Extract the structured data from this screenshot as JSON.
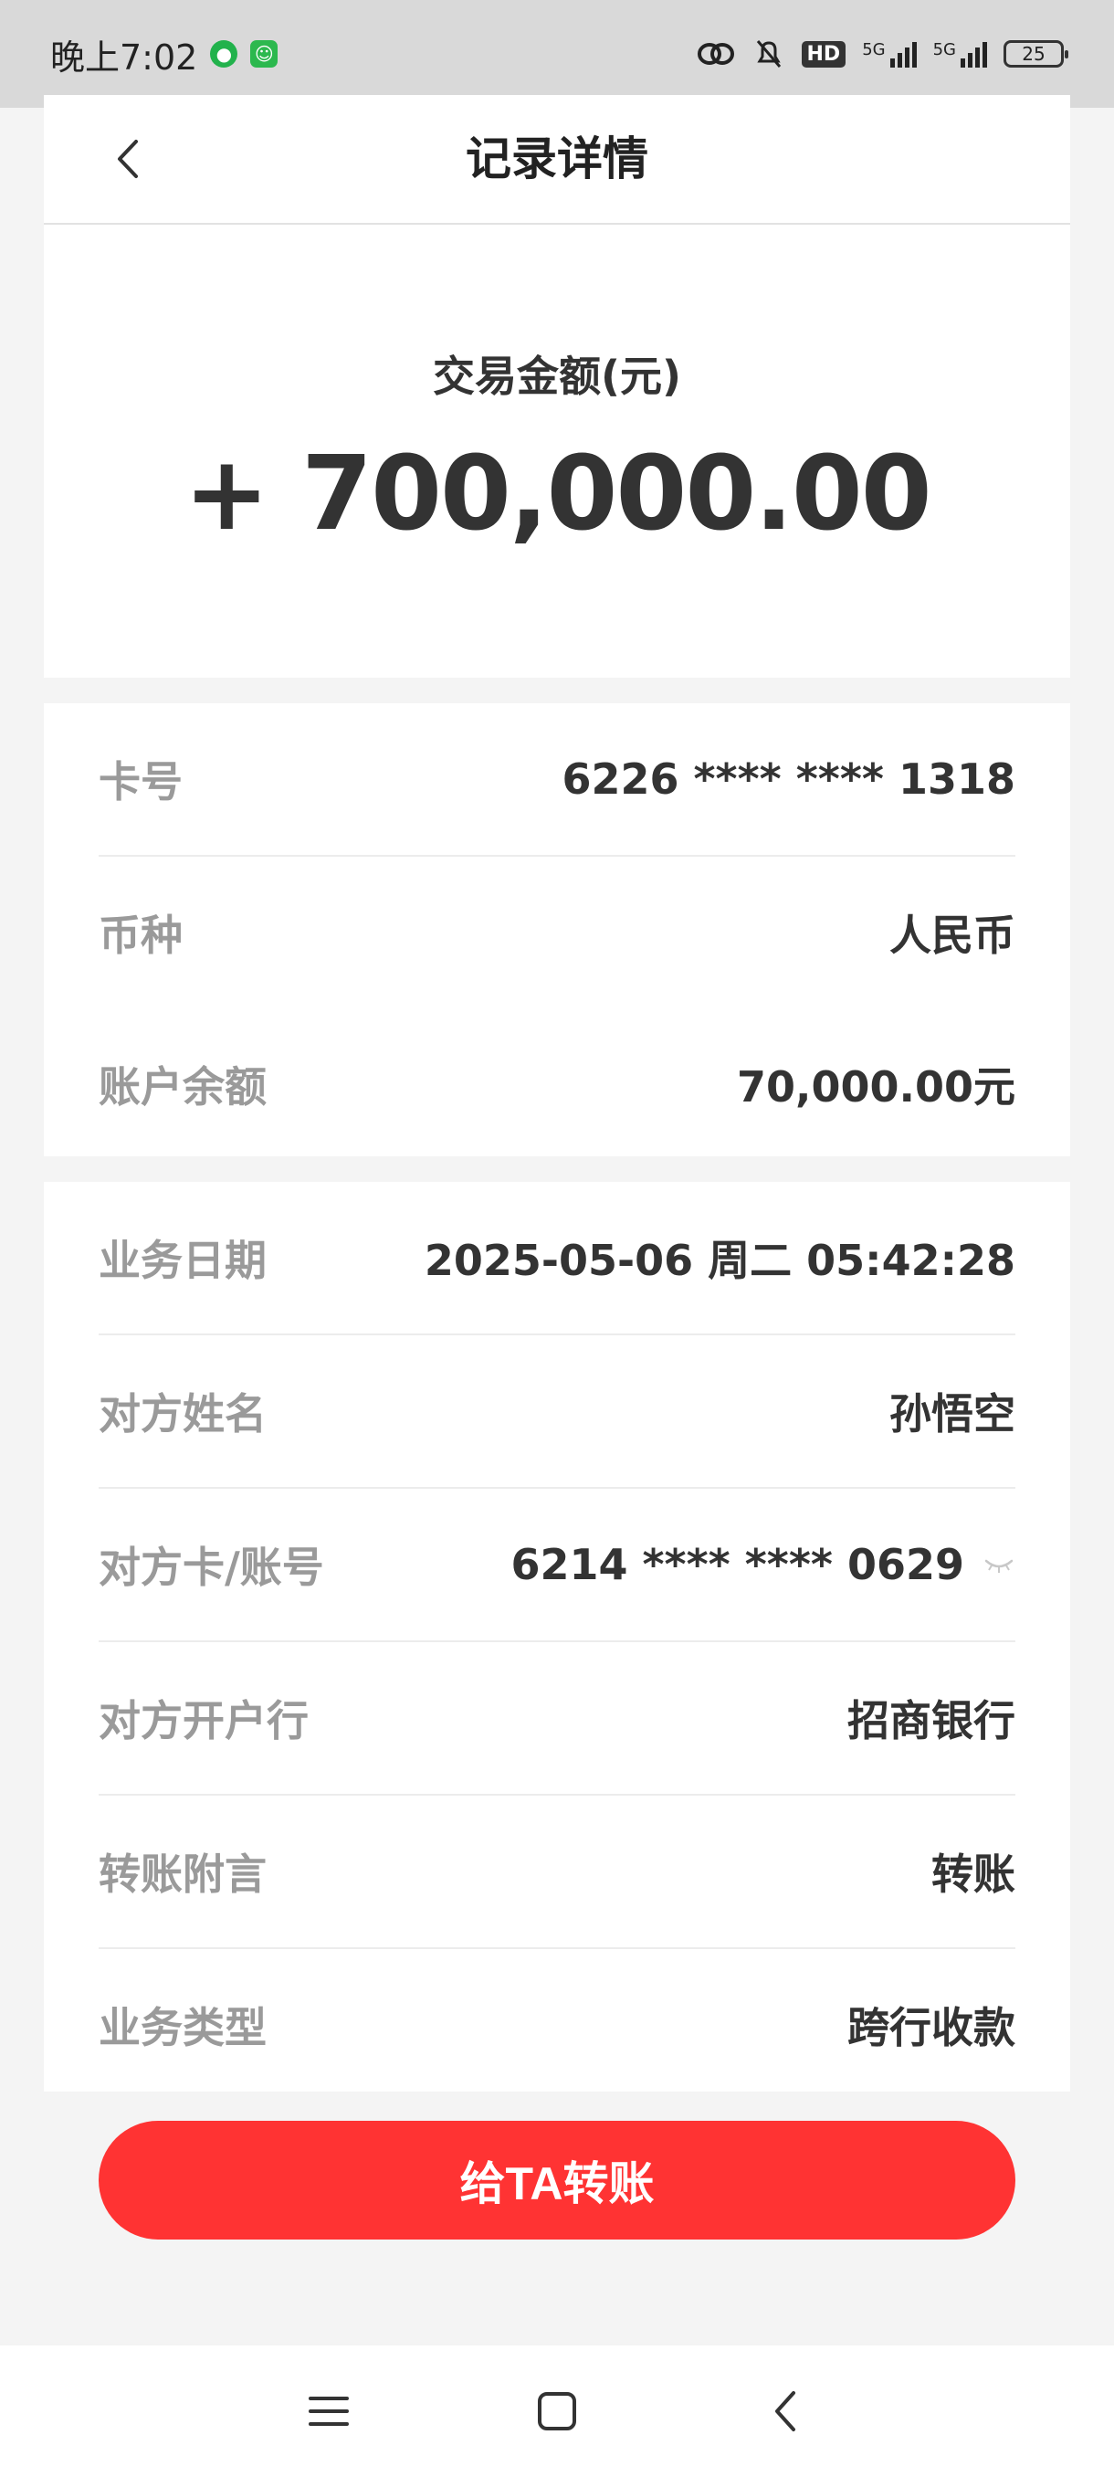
{
  "status_bar": {
    "time": "晚上7:02",
    "network_badge": "HD",
    "signal_1_label": "5G",
    "signal_2_label": "5G",
    "battery": "25",
    "icons": [
      "wechat-icon",
      "app-icon",
      "link-icon",
      "mute-bell-icon"
    ]
  },
  "header": {
    "title": "记录详情",
    "back_icon": "chevron-left-icon"
  },
  "amount": {
    "label": "交易金额(元)",
    "value": "+ 700,000.00"
  },
  "account_info": [
    {
      "label": "卡号",
      "value": "6226 **** **** 1318"
    },
    {
      "label": "币种",
      "value": "人民币"
    },
    {
      "label": "账户余额",
      "value": "70,000.00元"
    }
  ],
  "transaction_info": [
    {
      "label": "业务日期",
      "value": "2025-05-06 周二 05:42:28"
    },
    {
      "label": "对方姓名",
      "value": "孙悟空"
    },
    {
      "label": "对方卡/账号",
      "value": "6214 **** **** 0629"
    },
    {
      "label": "对方开户行",
      "value": "招商银行"
    },
    {
      "label": "转账附言",
      "value": "转账"
    },
    {
      "label": "业务类型",
      "value": "跨行收款"
    }
  ],
  "action": {
    "transfer_label": "给TA转账"
  },
  "nav": {
    "icons": [
      "menu-icon",
      "home-icon",
      "back-icon"
    ]
  },
  "colors": {
    "accent": "#ff3333",
    "label_gray": "#9a9a9a",
    "text_dark": "#333333",
    "background": "#f4f4f4"
  }
}
